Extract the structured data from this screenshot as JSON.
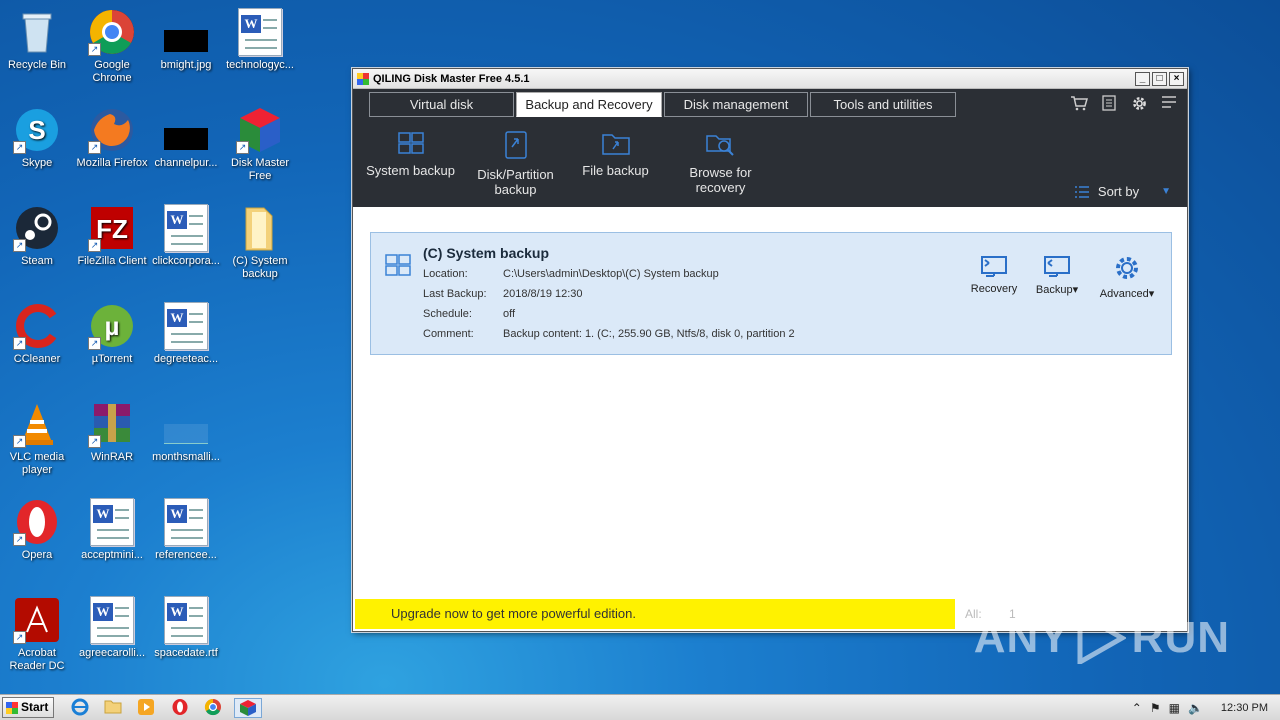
{
  "desktop": {
    "icons": [
      {
        "label": "Recycle Bin"
      },
      {
        "label": "Google Chrome"
      },
      {
        "label": "bmight.jpg"
      },
      {
        "label": "technologyc..."
      },
      {
        "label": "Skype"
      },
      {
        "label": "Mozilla Firefox"
      },
      {
        "label": "channelpur..."
      },
      {
        "label": "Disk Master Free"
      },
      {
        "label": "Steam"
      },
      {
        "label": "FileZilla Client"
      },
      {
        "label": "clickcorpora..."
      },
      {
        "label": "(C) System backup"
      },
      {
        "label": "CCleaner"
      },
      {
        "label": "µTorrent"
      },
      {
        "label": "degreeteac..."
      },
      {
        "label": "VLC media player"
      },
      {
        "label": "WinRAR"
      },
      {
        "label": "monthsmalli..."
      },
      {
        "label": "Opera"
      },
      {
        "label": "acceptmini..."
      },
      {
        "label": "referencee..."
      },
      {
        "label": "Acrobat Reader DC"
      },
      {
        "label": "agreecarolli..."
      },
      {
        "label": "spacedate.rtf"
      }
    ]
  },
  "window": {
    "title": "QILING Disk Master Free 4.5.1",
    "minimize": "_",
    "maximize": "□",
    "close": "×"
  },
  "tabs": [
    {
      "label": "Virtual disk"
    },
    {
      "label": "Backup and Recovery"
    },
    {
      "label": "Disk management"
    },
    {
      "label": "Tools and utilities"
    }
  ],
  "toolbar": {
    "items": [
      {
        "label": "System backup"
      },
      {
        "label": "Disk/Partition backup"
      },
      {
        "label": "File backup"
      },
      {
        "label": "Browse for recovery"
      }
    ],
    "sort_label": "Sort by"
  },
  "backup_card": {
    "title": "(C) System backup",
    "fields": [
      {
        "key": "Location:",
        "value": "C:\\Users\\admin\\Desktop\\(C) System backup"
      },
      {
        "key": "Last Backup:",
        "value": "2018/8/19 12:30"
      },
      {
        "key": "Schedule:",
        "value": "off"
      },
      {
        "key": "Comment:",
        "value": "Backup content:  1. (C:, 255.90 GB, Ntfs/8, disk 0, partition 2"
      }
    ],
    "actions": [
      {
        "label": "Recovery"
      },
      {
        "label": "Backup▾"
      },
      {
        "label": "Advanced▾"
      }
    ]
  },
  "footer": {
    "upgrade_text": "Upgrade now to get more powerful edition.",
    "all_label": "All:",
    "all_count": "1"
  },
  "watermark": {
    "text": "ANY",
    "text2": "RUN"
  },
  "taskbar": {
    "start_label": "Start",
    "clock": "12:30 PM"
  },
  "colors": {
    "accent": "#3b82d6",
    "dark_bar": "#2b2f35",
    "card_bg": "#dbe9f8",
    "upgrade_bg": "#fff200"
  }
}
